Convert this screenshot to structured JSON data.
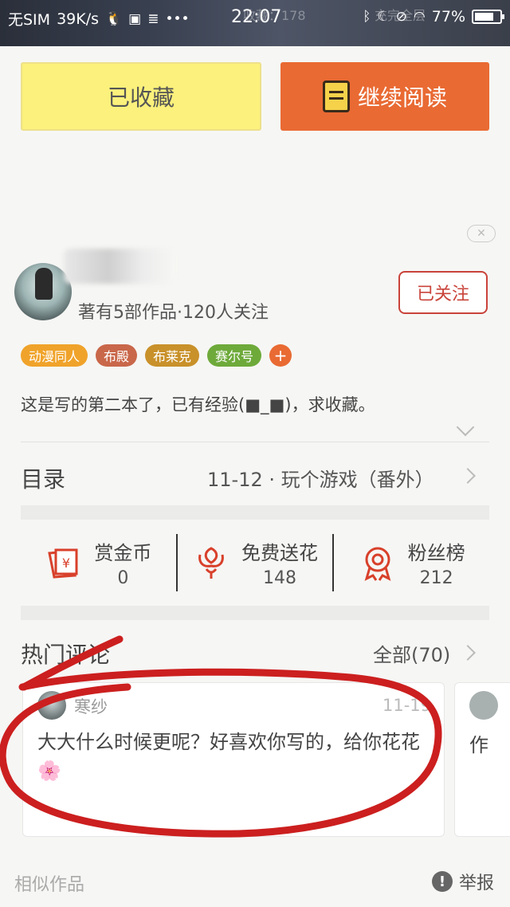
{
  "status_bar": {
    "carrier": "无SIM",
    "speed": "39K/s",
    "time": "22:07",
    "battery": "77%",
    "battery_level": 0.77,
    "background_text_left": "收藏：178",
    "background_text_right": "充完全层"
  },
  "actions": {
    "collected_label": "已收藏",
    "continue_label": "继续阅读"
  },
  "close_symbol": "✕",
  "author": {
    "meta": "著有5部作品·120人关注",
    "follow_label": "已关注"
  },
  "tags": [
    {
      "label": "动漫同人",
      "color": "#f0a32a"
    },
    {
      "label": "布殿",
      "color": "#c9674a"
    },
    {
      "label": "布莱克",
      "color": "#c9912a"
    },
    {
      "label": "赛尔号",
      "color": "#6eaa3a"
    }
  ],
  "tag_add": "+",
  "synopsis": "这是写的第二本了，已有经验(■_■)，求收藏。",
  "toc": {
    "title": "目录",
    "latest": "11-12 · 玩个游戏（番外）"
  },
  "stats": [
    {
      "label": "赏金币",
      "value": "0",
      "icon": "red-envelope-icon"
    },
    {
      "label": "免费送花",
      "value": "148",
      "icon": "flower-icon"
    },
    {
      "label": "粉丝榜",
      "value": "212",
      "icon": "medal-icon"
    }
  ],
  "comments": {
    "title": "热门评论",
    "all_label": "全部(70)",
    "items": [
      {
        "user": "寒纱",
        "time": "11-19",
        "text": "大大什么时候更呢？好喜欢你写的，给你花花🌸"
      }
    ],
    "partial_text": "作"
  },
  "footer": {
    "similar_label": "相似作品",
    "report_label": "举报"
  },
  "colors": {
    "accent_orange": "#e96a33",
    "collected_yellow": "#fbf17c",
    "follow_red": "#c9433a",
    "annotation_red": "#cc1f1f"
  }
}
